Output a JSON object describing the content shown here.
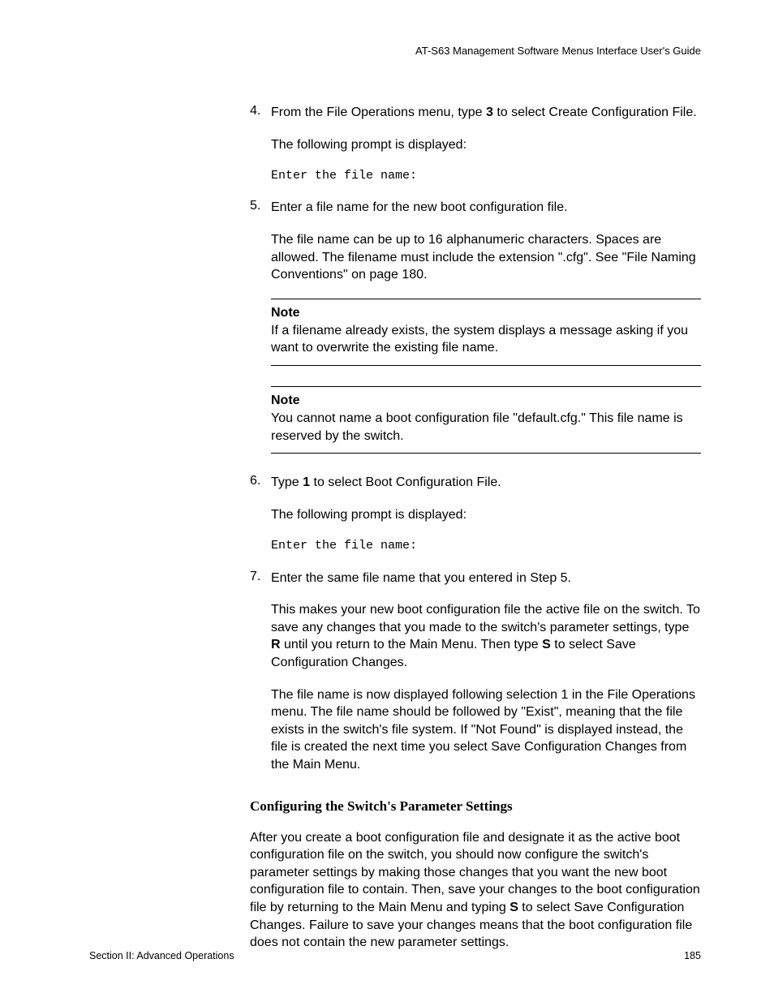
{
  "header": {
    "guide_title": "AT-S63 Management Software Menus Interface User's Guide"
  },
  "steps": {
    "s4": {
      "num": "4.",
      "p1a": "From the File Operations menu, type ",
      "p1b": "3",
      "p1c": " to select Create Configuration File.",
      "p2": "The following prompt is displayed:",
      "p3": "Enter the file name:"
    },
    "s5": {
      "num": "5.",
      "p1": "Enter a file name for the new boot configuration file.",
      "p2": "The file name can be up to 16 alphanumeric characters. Spaces are allowed. The filename must include the extension \".cfg\". See \"File Naming Conventions\" on page 180."
    },
    "note1": {
      "label": "Note",
      "text": "If a filename already exists, the system displays a message asking if you want to overwrite the existing file name."
    },
    "note2": {
      "label": "Note",
      "text": "You cannot name a boot configuration file \"default.cfg.\" This file name is reserved by the switch."
    },
    "s6": {
      "num": "6.",
      "p1a": "Type ",
      "p1b": "1",
      "p1c": " to select Boot Configuration File.",
      "p2": "The following prompt is displayed:",
      "p3": "Enter the file name:"
    },
    "s7": {
      "num": "7.",
      "p1": "Enter the same file name that you entered in Step 5.",
      "p2a": "This makes your new boot configuration file the active file on the switch. To save any changes that you made to the switch's parameter settings, type ",
      "p2b": "R",
      "p2c": " until you return to the Main Menu. Then type ",
      "p2d": "S",
      "p2e": " to select Save Configuration Changes.",
      "p3": "The file name is now displayed following selection 1 in the File Operations menu. The file name should be followed by \"Exist\", meaning that the file exists in the switch's file system. If \"Not Found\" is displayed instead, the file is created the next time you select Save Configuration Changes from the Main Menu."
    }
  },
  "subheading": "Configuring the Switch's Parameter Settings",
  "body": {
    "p1a": "After you create a boot configuration file and designate it as the active boot configuration file on the switch, you should now configure the switch's parameter settings by making those changes that you want the new boot configuration file to contain. Then, save your changes to the boot configuration file by returning to the Main Menu and typing ",
    "p1b": "S",
    "p1c": " to select Save Configuration Changes. Failure to save your changes means that the boot configuration file does not contain the new parameter settings."
  },
  "footer": {
    "section": "Section II: Advanced Operations",
    "page": "185"
  }
}
